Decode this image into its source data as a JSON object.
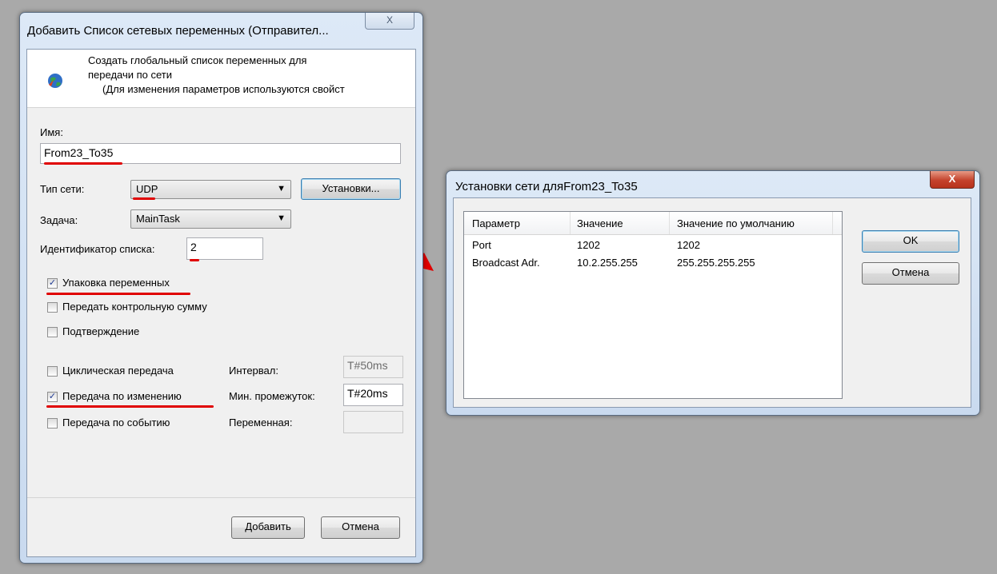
{
  "dialog1": {
    "title": "Добавить Список сетевых переменных (Отправител...",
    "close_glyph": "X",
    "description": [
      "Создать глобальный список переменных для",
      "передачи по сети",
      "(Для изменения параметров используются свойст"
    ],
    "name_label": "Имя:",
    "name_value": "From23_To35",
    "network_type_label": "Тип сети:",
    "network_type_value": "UDP",
    "settings_button": "Установки...",
    "task_label": "Задача:",
    "task_value": "MainTask",
    "list_id_label": "Идентификатор списка:",
    "list_id_value": "2",
    "checkboxes": [
      {
        "label": "Упаковка переменных",
        "checked": true
      },
      {
        "label": "Передать контрольную сумму",
        "checked": false
      },
      {
        "label": "Подтверждение",
        "checked": false
      },
      {
        "label": "Циклическая передача",
        "checked": false
      },
      {
        "label": "Передача по изменению",
        "checked": true
      },
      {
        "label": "Передача по событию",
        "checked": false
      }
    ],
    "interval_label": "Интервал:",
    "interval_value": "T#50ms",
    "min_gap_label": "Мин. промежуток:",
    "min_gap_value": "T#20ms",
    "variable_label": "Переменная:",
    "variable_value": "",
    "add_button": "Добавить",
    "cancel_button": "Отмена"
  },
  "dialog2": {
    "title": "Установки сети дляFrom23_To35",
    "close_glyph": "X",
    "columns": [
      "Параметр",
      "Значение",
      "Значение по умолчанию"
    ],
    "rows": [
      [
        "Port",
        "1202",
        "1202"
      ],
      [
        "Broadcast Adr.",
        "10.2.255.255",
        "255.255.255.255"
      ]
    ],
    "ok_button": "OK",
    "cancel_button": "Отмена"
  },
  "colors": {
    "annotation": "#e00000",
    "desktop": "#a9a9a9",
    "close_button_red": "#c4422c"
  }
}
